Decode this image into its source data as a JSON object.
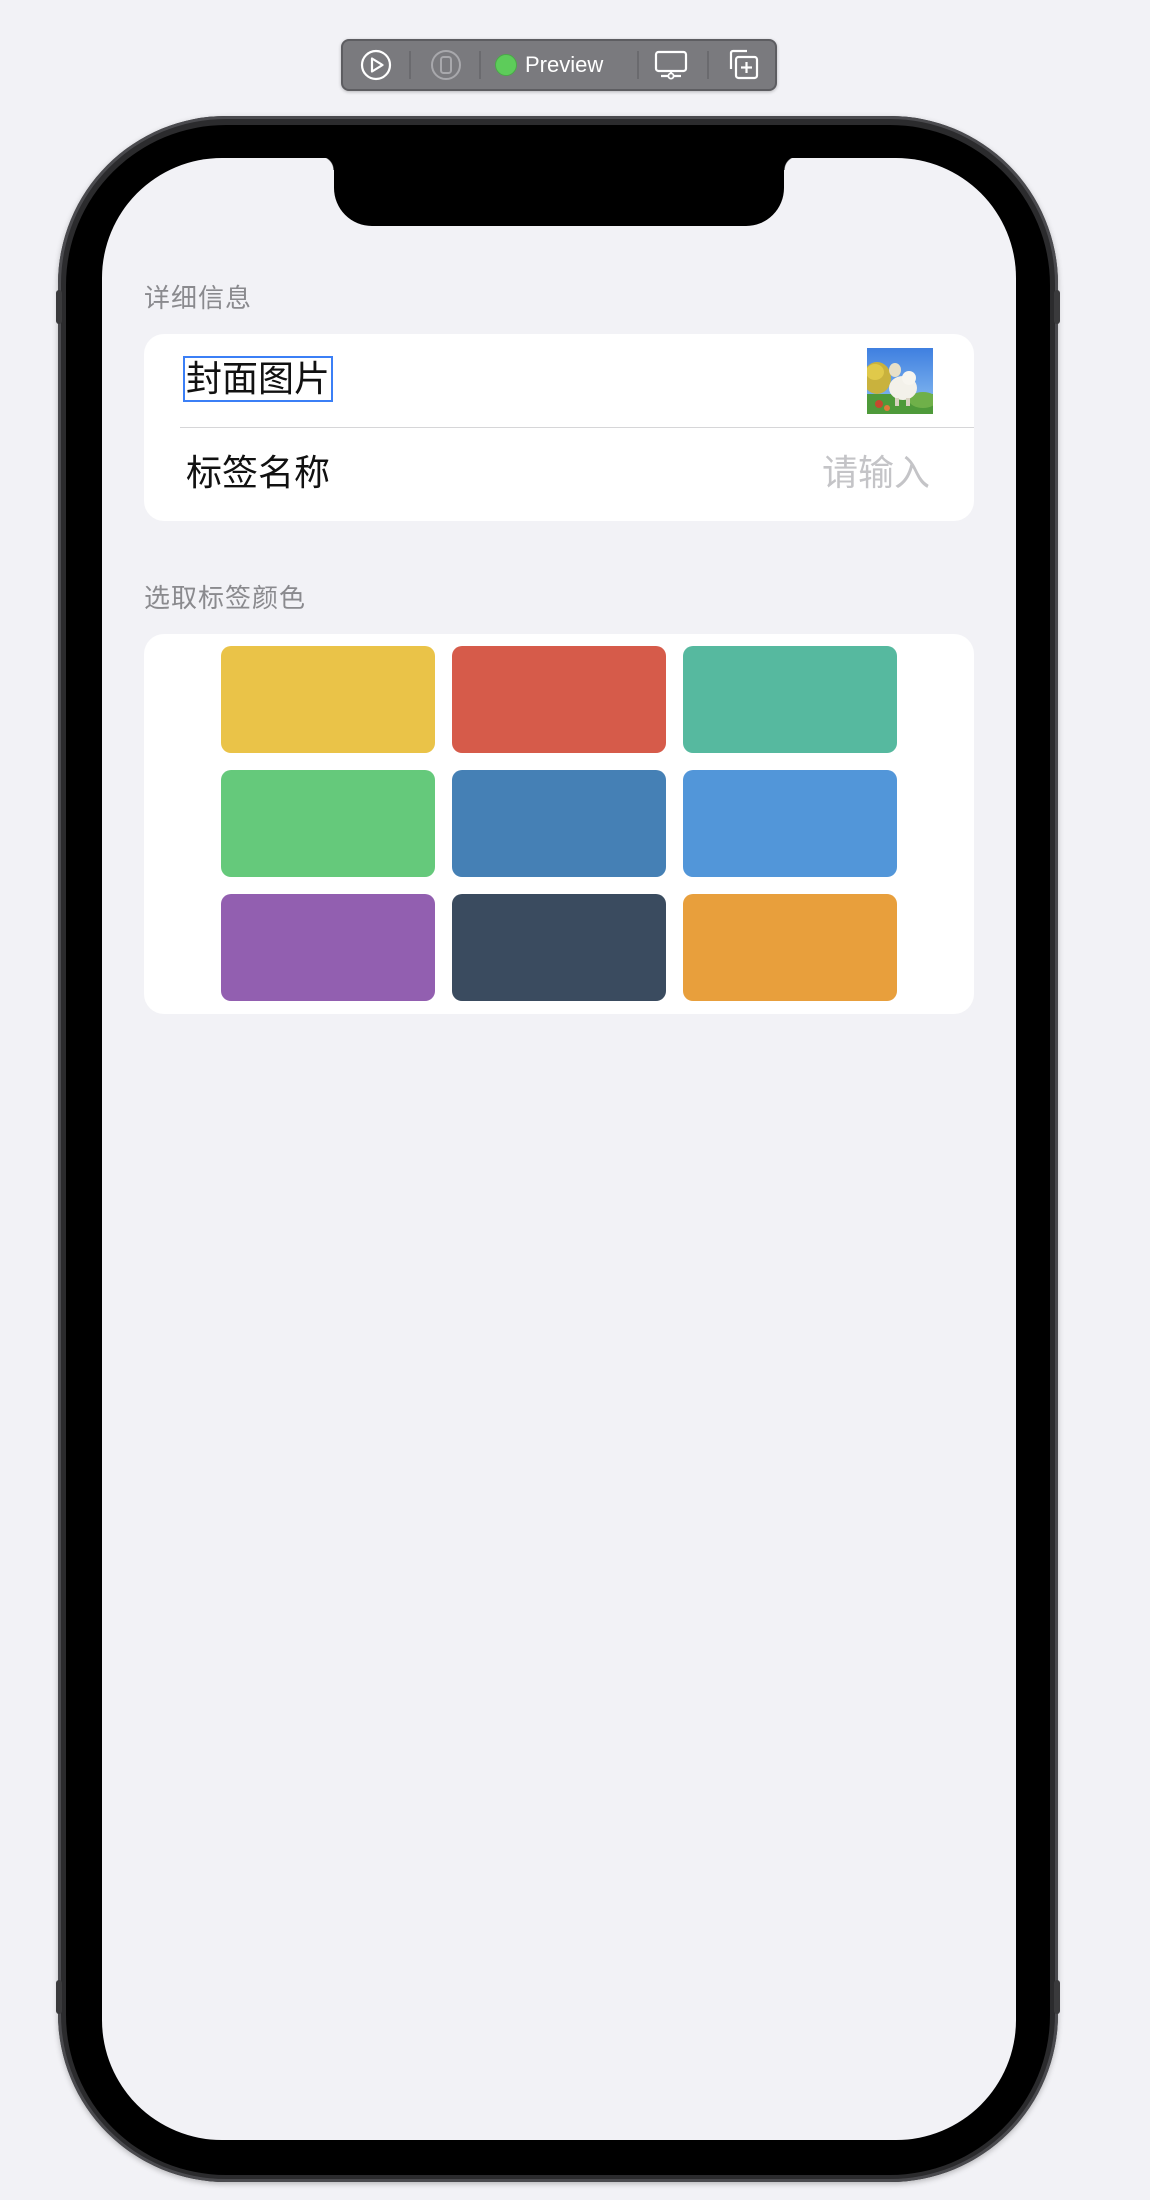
{
  "toolbar": {
    "preview_label": "Preview",
    "play_icon": "play-circle-icon",
    "device_icon": "device-icon",
    "display_icon": "display-settings-icon",
    "duplicate_icon": "duplicate-add-icon",
    "status_color": "#5dcc5a"
  },
  "form": {
    "details": {
      "header": "详细信息",
      "cover": {
        "label": "封面图片",
        "image": "cover-thumbnail"
      },
      "tag_name": {
        "label": "标签名称",
        "placeholder": "请输入"
      }
    },
    "color_picker": {
      "header": "选取标签颜色",
      "colors": [
        "#eac348",
        "#d65b4a",
        "#56b99f",
        "#65c97b",
        "#4580b5",
        "#5296d9",
        "#925fb0",
        "#3a4b5f",
        "#e89f3c"
      ]
    }
  }
}
